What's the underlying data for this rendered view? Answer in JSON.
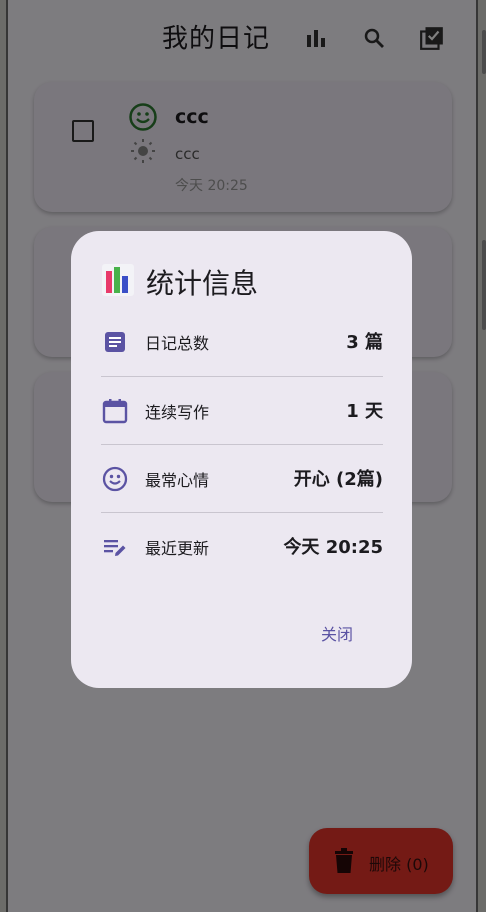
{
  "app": {
    "title": "我的日记"
  },
  "entries": [
    {
      "title": "ccc",
      "subtitle": "ccc",
      "time": "今天 20:25"
    }
  ],
  "fab": {
    "label": "删除 (0)"
  },
  "dialog": {
    "title": "统计信息",
    "rows": [
      {
        "label": "日记总数",
        "value": "3 篇",
        "icon": "note-icon"
      },
      {
        "label": "连续写作",
        "value": "1 天",
        "icon": "calendar-icon"
      },
      {
        "label": "最常心情",
        "value": "开心 (2篇)",
        "icon": "smile-icon"
      },
      {
        "label": "最近更新",
        "value": "今天 20:25",
        "icon": "edit-note-icon"
      }
    ],
    "close_label": "关闭"
  },
  "colors": {
    "accent": "#5b53a3",
    "mood_happy": "#2e7d32",
    "fab": "#e8352a"
  }
}
